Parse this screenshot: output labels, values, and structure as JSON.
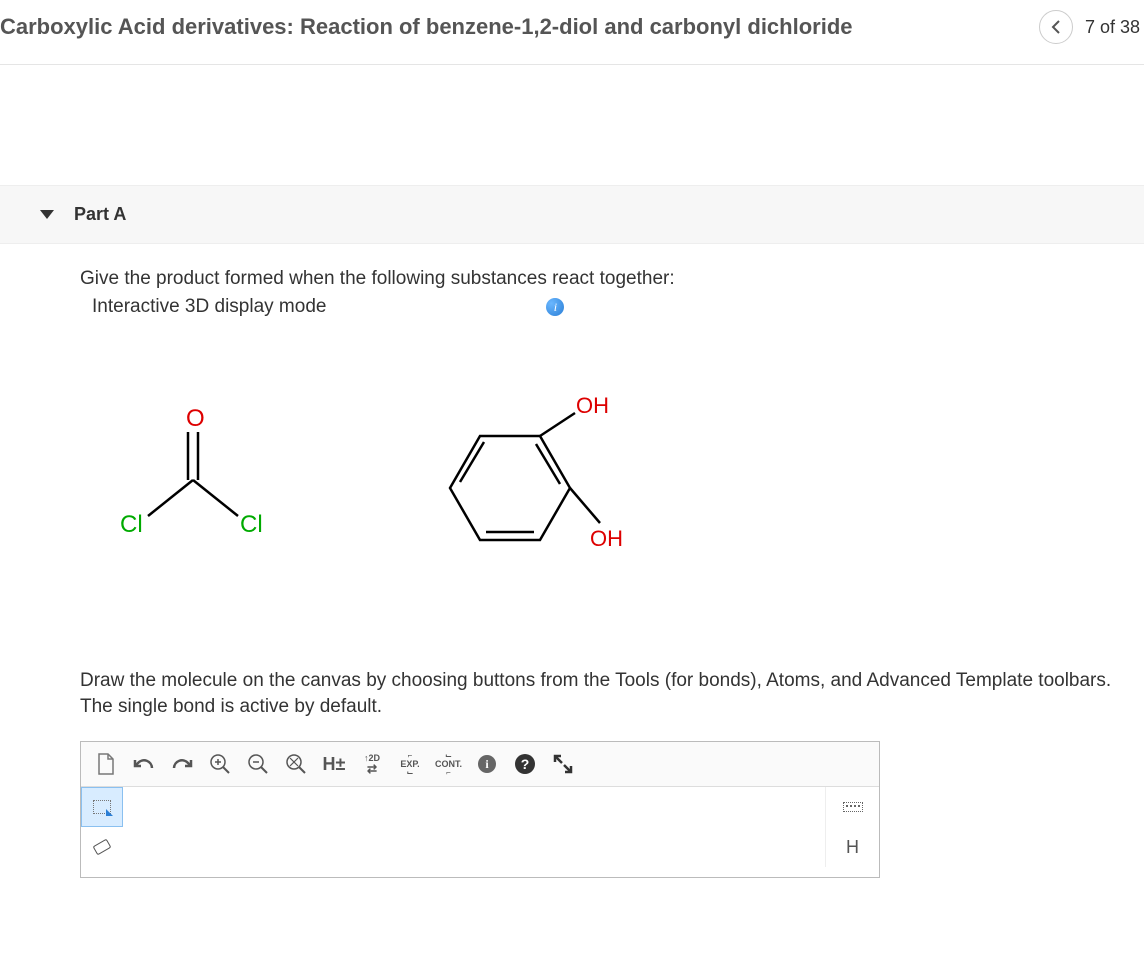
{
  "header": {
    "title": "Carboxylic Acid derivatives: Reaction of benzene-1,2-diol and carbonyl dichloride",
    "page_indicator": "7 of 38"
  },
  "part": {
    "label": "Part A"
  },
  "question": {
    "prompt": "Give the product formed when the following substances react together:",
    "display_mode": "Interactive 3D display mode",
    "instructions": "Draw the molecule on the canvas by choosing buttons from the Tools (for bonds), Atoms, and Advanced Template toolbars. The single bond is active by default."
  },
  "molecules": {
    "reagent1": {
      "top": "O",
      "left": "Cl",
      "right": "Cl"
    },
    "reagent2": {
      "top": "OH",
      "bottom": "OH"
    }
  },
  "toolbar": {
    "new": "new-file",
    "undo": "undo",
    "redo": "redo",
    "zoom_in": "zoom-in",
    "zoom_out": "zoom-out",
    "zoom_fit": "zoom-fit",
    "h_toggle": "H±",
    "view2d": "2D",
    "exp": "EXP.",
    "cont": "CONT.",
    "info": "i",
    "help": "?",
    "fullscreen": "fullscreen"
  },
  "sidebar_right": {
    "atom_h": "H"
  }
}
